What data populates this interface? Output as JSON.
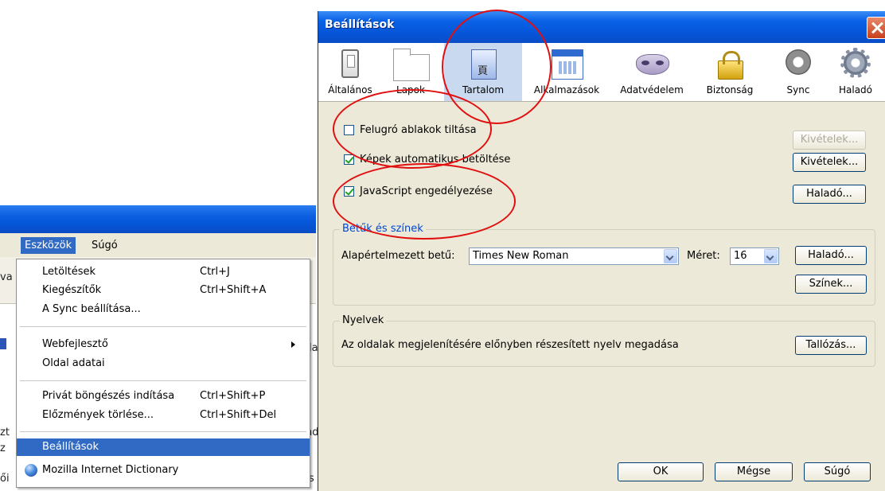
{
  "colors": {
    "titlebar_blue": "#0a5fe0",
    "dialog_face": "#ece9d8",
    "highlight": "#316ac5",
    "annotation_red": "#e01010",
    "checkmark_green": "#21a121"
  },
  "menubar": {
    "tools": "Eszközök",
    "help": "Súgó"
  },
  "background_fragments": [
    "va",
    "la",
    "zt",
    "z",
    "nd",
    "ői",
    "s"
  ],
  "tools_menu": {
    "downloads": {
      "label": "Letöltések",
      "shortcut": "Ctrl+J"
    },
    "addons": {
      "label": "Kiegészítők",
      "shortcut": "Ctrl+Shift+A"
    },
    "sync_setup": {
      "label": "A Sync beállítása..."
    },
    "web_developer": {
      "label": "Webfejlesztő"
    },
    "page_info": {
      "label": "Oldal adatai"
    },
    "private_browsing": {
      "label": "Privát böngészés indítása",
      "shortcut": "Ctrl+Shift+P"
    },
    "clear_history": {
      "label": "Előzmények törlése...",
      "shortcut": "Ctrl+Shift+Del"
    },
    "options": {
      "label": "Beállítások"
    },
    "dictionary": {
      "label": "Mozilla Internet Dictionary",
      "icon": "globe-icon"
    }
  },
  "dialog": {
    "title": "Beállítások",
    "panes": [
      {
        "label": "Általános",
        "icon": "general-switch-icon"
      },
      {
        "label": "Lapok",
        "icon": "tabs-folder-icon"
      },
      {
        "label": "Tartalom",
        "icon": "content-page-icon",
        "selected": true
      },
      {
        "label": "Alkalmazások",
        "icon": "applications-window-icon"
      },
      {
        "label": "Adatvédelem",
        "icon": "privacy-mask-icon"
      },
      {
        "label": "Biztonság",
        "icon": "security-lock-icon"
      },
      {
        "label": "Sync",
        "icon": "sync-icon"
      },
      {
        "label": "Haladó",
        "icon": "advanced-gear-icon"
      }
    ],
    "popups": {
      "label": "Felugró ablakok tiltása",
      "checked": false,
      "button": "Kivételek..."
    },
    "images": {
      "label": "Képek automatikus betöltése",
      "checked": true,
      "button": "Kivételek..."
    },
    "javascript": {
      "label": "JavaScript engedélyezése",
      "checked": true,
      "button": "Haladó..."
    },
    "fonts": {
      "group_label": "Betűk és színek",
      "default_font_label": "Alapértelmezett betű:",
      "default_font_value": "Times New Roman",
      "size_label": "Méret:",
      "size_value": "16",
      "advanced_button": "Haladó...",
      "colors_button": "Színek..."
    },
    "languages": {
      "group_label": "Nyelvek",
      "description": "Az oldalak megjelenítésére előnyben részesített nyelv megadása",
      "browse_button": "Tallózás..."
    },
    "footer": {
      "ok": "OK",
      "cancel": "Mégse",
      "help": "Súgó"
    }
  }
}
